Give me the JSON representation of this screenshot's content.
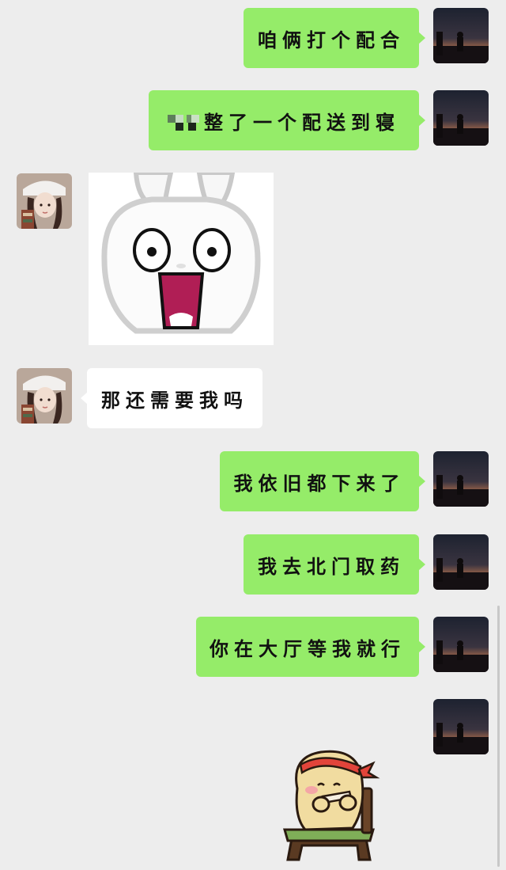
{
  "chat": {
    "messages": [
      {
        "id": "m1",
        "side": "out",
        "text": "咱俩打个配合"
      },
      {
        "id": "m2",
        "side": "out",
        "text": "整了一个配送到寝",
        "redacted_prefix": true
      },
      {
        "id": "m3",
        "side": "in",
        "type": "sticker",
        "sticker": "shocked-rabbit-sticker"
      },
      {
        "id": "m4",
        "side": "in",
        "text": "那还需要我吗"
      },
      {
        "id": "m5",
        "side": "out",
        "text": "我依旧都下来了"
      },
      {
        "id": "m6",
        "side": "out",
        "text": "我去北门取药"
      },
      {
        "id": "m7",
        "side": "out",
        "text": "你在大厅等我就行"
      },
      {
        "id": "m8",
        "side": "out",
        "type": "sticker",
        "sticker": "bear-eating-sticker"
      }
    ]
  },
  "colors": {
    "background": "#ededed",
    "outgoing_bubble": "#95ec69",
    "incoming_bubble": "#ffffff",
    "text": "#111111"
  }
}
